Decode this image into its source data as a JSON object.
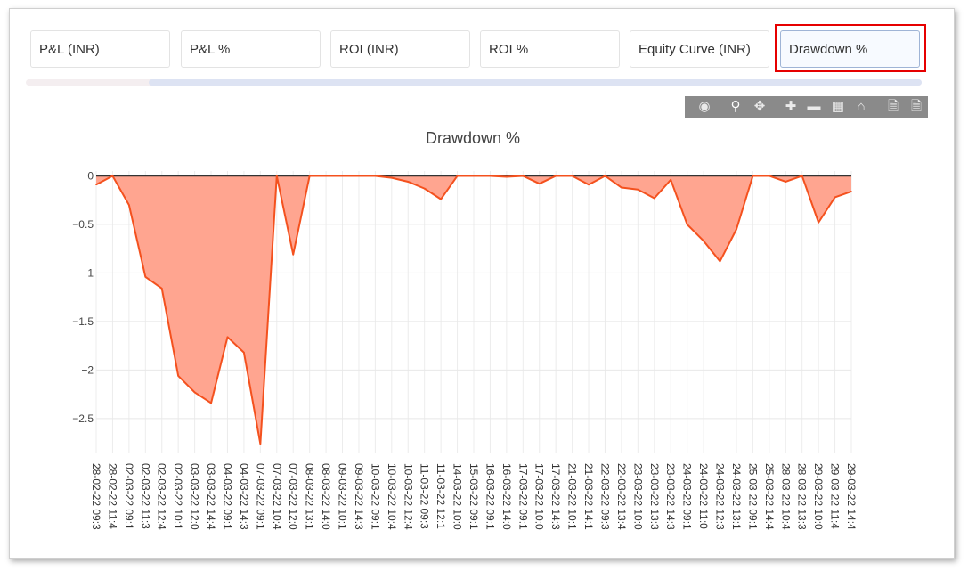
{
  "tabs": [
    {
      "label": "P&L (INR)"
    },
    {
      "label": "P&L %"
    },
    {
      "label": "ROI (INR)"
    },
    {
      "label": "ROI %"
    },
    {
      "label": "Equity Curve (INR)"
    },
    {
      "label": "Drawdown %"
    }
  ],
  "active_tab": "Drawdown %",
  "modebar": [
    "camera-icon",
    "zoom-icon",
    "pan-icon",
    "zoom-in-icon",
    "zoom-out-icon",
    "autoscale-icon",
    "reset-axes-icon",
    "download-csv-icon",
    "download-json-icon"
  ],
  "colors": {
    "fill": "#ffa590",
    "line": "#f4511e",
    "highlight": "#e60000",
    "modebar": "#8a8a8a"
  },
  "chart_data": {
    "type": "area",
    "title": "Drawdown %",
    "xlabel": "",
    "ylabel": "",
    "ylim": [
      -2.85,
      0.05
    ],
    "yticks": [
      "0",
      "−0.5",
      "−1",
      "−1.5",
      "−2",
      "−2.5"
    ],
    "grid": true,
    "x": [
      "28-02-22 09:3",
      "28-02-22 11:4",
      "02-03-22 09:1",
      "02-03-22 11:3",
      "02-03-22 12:4",
      "02-03-22 10:1",
      "03-03-22 12:0",
      "03-03-22 14:4",
      "04-03-22 09:1",
      "04-03-22 14:3",
      "07-03-22 09:1",
      "07-03-22 10:4",
      "07-03-22 12:0",
      "08-03-22 13:1",
      "08-03-22 14:0",
      "09-03-22 10:1",
      "09-03-22 14:3",
      "10-03-22 09:1",
      "10-03-22 10:4",
      "10-03-22 12:4",
      "11-03-22 09:3",
      "11-03-22 12:1",
      "14-03-22 10:0",
      "15-03-22 09:1",
      "16-03-22 09:1",
      "16-03-22 14:0",
      "17-03-22 09:1",
      "17-03-22 10:0",
      "17-03-22 14:3",
      "21-03-22 10:1",
      "21-03-22 14:1",
      "22-03-22 09:3",
      "22-03-22 13:4",
      "23-03-22 10:0",
      "23-03-22 13:3",
      "23-03-22 14:3",
      "24-03-22 09:1",
      "24-03-22 11:0",
      "24-03-22 12:3",
      "24-03-22 13:1",
      "25-03-22 09:1",
      "25-03-22 14:4",
      "28-03-22 10:4",
      "28-03-22 13:3",
      "29-03-22 10:0",
      "29-03-22 11:4",
      "29-03-22 14:4"
    ],
    "series": [
      {
        "values": [
          -0.09,
          0,
          -0.3,
          -1.04,
          -1.16,
          -2.06,
          -2.23,
          -2.34,
          -1.66,
          -1.82,
          -2.76,
          0,
          -0.81,
          0,
          0,
          0,
          0,
          0,
          -0.02,
          -0.06,
          -0.13,
          -0.24,
          0,
          0,
          0,
          -0.01,
          0,
          -0.08,
          0,
          0,
          -0.09,
          0,
          -0.12,
          -0.14,
          -0.23,
          -0.04,
          -0.5,
          -0.67,
          -0.88,
          -0.55,
          0,
          0,
          -0.06,
          0,
          -0.48,
          -0.22,
          -0.16
        ]
      }
    ]
  }
}
